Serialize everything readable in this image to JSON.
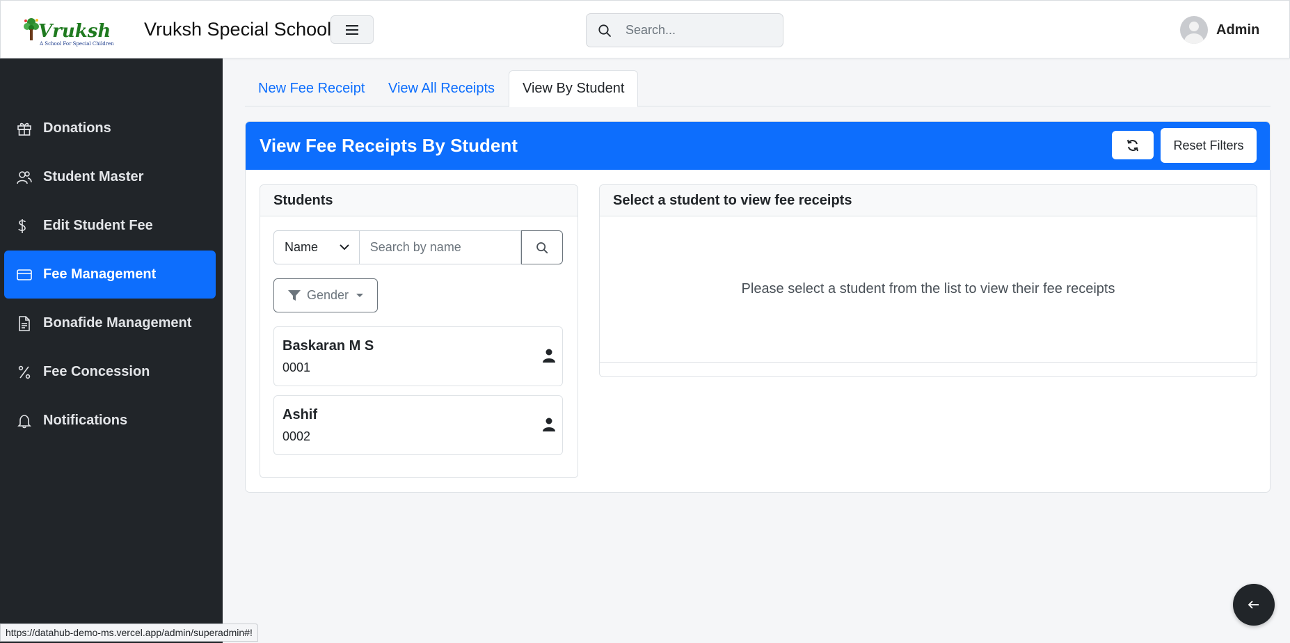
{
  "header": {
    "brand": "Vruksh Special School",
    "logo_text": "Vruksh",
    "logo_tagline": "A School For Special Children",
    "search_placeholder": "Search...",
    "user_name": "Admin"
  },
  "sidebar": {
    "items": [
      {
        "label": "Donations",
        "icon": "gift-icon",
        "active": false
      },
      {
        "label": "Student Master",
        "icon": "users-icon",
        "active": false
      },
      {
        "label": "Edit Student Fee",
        "icon": "dollar-icon",
        "active": false
      },
      {
        "label": "Fee Management",
        "icon": "credit-card-icon",
        "active": true
      },
      {
        "label": "Bonafide Management",
        "icon": "document-icon",
        "active": false
      },
      {
        "label": "Fee Concession",
        "icon": "percent-icon",
        "active": false
      },
      {
        "label": "Notifications",
        "icon": "bell-icon",
        "active": false
      }
    ]
  },
  "tabs": [
    {
      "label": "New Fee Receipt",
      "active": false
    },
    {
      "label": "View All Receipts",
      "active": false
    },
    {
      "label": "View By Student",
      "active": true
    }
  ],
  "main": {
    "title": "View Fee Receipts By Student",
    "reset_label": "Reset Filters",
    "students": {
      "title": "Students",
      "search_by": "Name",
      "search_placeholder": "Search by name",
      "gender_label": "Gender",
      "list": [
        {
          "name": "Baskaran M S",
          "id": "0001"
        },
        {
          "name": "Ashif",
          "id": "0002"
        }
      ]
    },
    "receipts": {
      "title": "Select a student to view fee receipts",
      "empty_message": "Please select a student from the list to view their fee receipts"
    }
  },
  "status_url": "https://datahub-demo-ms.vercel.app/admin/superadmin#!",
  "colors": {
    "primary": "#0d6efd",
    "sidebar_bg": "#212529",
    "page_bg": "#f5f6f8"
  }
}
